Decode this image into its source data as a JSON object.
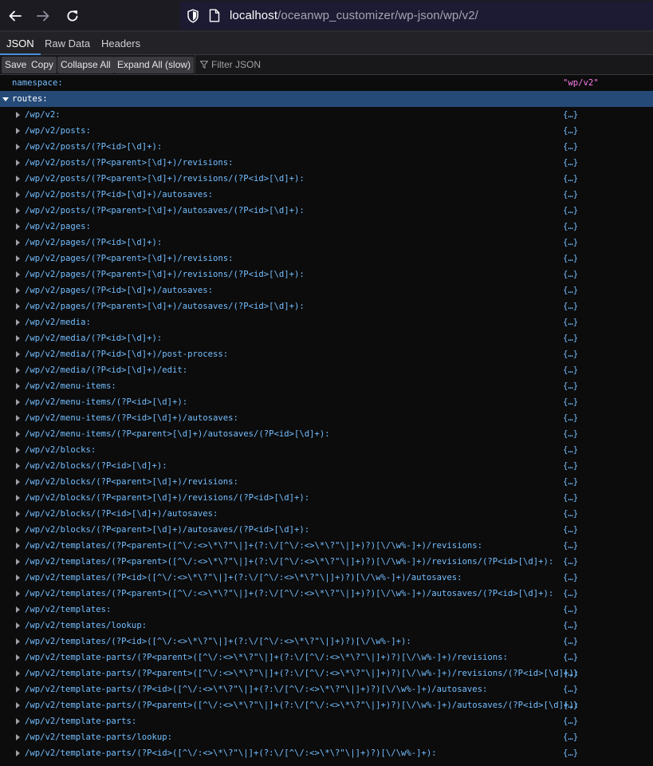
{
  "browser": {
    "back_icon": "arrow-left-icon",
    "forward_icon": "arrow-right-icon",
    "reload_icon": "reload-icon",
    "url_host": "localhost",
    "url_path": "/oceanwp_customizer/wp-json/wp/v2/"
  },
  "tabs": [
    {
      "label": "JSON",
      "active": true
    },
    {
      "label": "Raw Data",
      "active": false
    },
    {
      "label": "Headers",
      "active": false
    }
  ],
  "toolbar": {
    "save_label": "Save",
    "copy_label": "Copy",
    "collapse_label": "Collapse All",
    "expand_label": "Expand All (slow)",
    "filter_placeholder": "Filter JSON"
  },
  "tree": {
    "namespace_key": "namespace:",
    "namespace_value": "\"wp/v2\"",
    "routes_key": "routes:",
    "collapsed_value": "{…}",
    "routes": [
      "/wp/v2:",
      "/wp/v2/posts:",
      "/wp/v2/posts/(?P<id>[\\d]+):",
      "/wp/v2/posts/(?P<parent>[\\d]+)/revisions:",
      "/wp/v2/posts/(?P<parent>[\\d]+)/revisions/(?P<id>[\\d]+):",
      "/wp/v2/posts/(?P<id>[\\d]+)/autosaves:",
      "/wp/v2/posts/(?P<parent>[\\d]+)/autosaves/(?P<id>[\\d]+):",
      "/wp/v2/pages:",
      "/wp/v2/pages/(?P<id>[\\d]+):",
      "/wp/v2/pages/(?P<parent>[\\d]+)/revisions:",
      "/wp/v2/pages/(?P<parent>[\\d]+)/revisions/(?P<id>[\\d]+):",
      "/wp/v2/pages/(?P<id>[\\d]+)/autosaves:",
      "/wp/v2/pages/(?P<parent>[\\d]+)/autosaves/(?P<id>[\\d]+):",
      "/wp/v2/media:",
      "/wp/v2/media/(?P<id>[\\d]+):",
      "/wp/v2/media/(?P<id>[\\d]+)/post-process:",
      "/wp/v2/media/(?P<id>[\\d]+)/edit:",
      "/wp/v2/menu-items:",
      "/wp/v2/menu-items/(?P<id>[\\d]+):",
      "/wp/v2/menu-items/(?P<id>[\\d]+)/autosaves:",
      "/wp/v2/menu-items/(?P<parent>[\\d]+)/autosaves/(?P<id>[\\d]+):",
      "/wp/v2/blocks:",
      "/wp/v2/blocks/(?P<id>[\\d]+):",
      "/wp/v2/blocks/(?P<parent>[\\d]+)/revisions:",
      "/wp/v2/blocks/(?P<parent>[\\d]+)/revisions/(?P<id>[\\d]+):",
      "/wp/v2/blocks/(?P<id>[\\d]+)/autosaves:",
      "/wp/v2/blocks/(?P<parent>[\\d]+)/autosaves/(?P<id>[\\d]+):",
      "/wp/v2/templates/(?P<parent>([^\\/:<>\\*\\?\"\\|]+(?:\\/[^\\/:<>\\*\\?\"\\|]+)?)[\\/\\w%-]+)/revisions:",
      "/wp/v2/templates/(?P<parent>([^\\/:<>\\*\\?\"\\|]+(?:\\/[^\\/:<>\\*\\?\"\\|]+)?)[\\/\\w%-]+)/revisions/(?P<id>[\\d]+):",
      "/wp/v2/templates/(?P<id>([^\\/:<>\\*\\?\"\\|]+(?:\\/[^\\/:<>\\*\\?\"\\|]+)?)[\\/\\w%-]+)/autosaves:",
      "/wp/v2/templates/(?P<parent>([^\\/:<>\\*\\?\"\\|]+(?:\\/[^\\/:<>\\*\\?\"\\|]+)?)[\\/\\w%-]+)/autosaves/(?P<id>[\\d]+):",
      "/wp/v2/templates:",
      "/wp/v2/templates/lookup:",
      "/wp/v2/templates/(?P<id>([^\\/:<>\\*\\?\"\\|]+(?:\\/[^\\/:<>\\*\\?\"\\|]+)?)[\\/\\w%-]+):",
      "/wp/v2/template-parts/(?P<parent>([^\\/:<>\\*\\?\"\\|]+(?:\\/[^\\/:<>\\*\\?\"\\|]+)?)[\\/\\w%-]+)/revisions:",
      "/wp/v2/template-parts/(?P<parent>([^\\/:<>\\*\\?\"\\|]+(?:\\/[^\\/:<>\\*\\?\"\\|]+)?)[\\/\\w%-]+)/revisions/(?P<id>[\\d]+):",
      "/wp/v2/template-parts/(?P<id>([^\\/:<>\\*\\?\"\\|]+(?:\\/[^\\/:<>\\*\\?\"\\|]+)?)[\\/\\w%-]+)/autosaves:",
      "/wp/v2/template-parts/(?P<parent>([^\\/:<>\\*\\?\"\\|]+(?:\\/[^\\/:<>\\*\\?\"\\|]+)?)[\\/\\w%-]+)/autosaves/(?P<id>[\\d]+):",
      "/wp/v2/template-parts:",
      "/wp/v2/template-parts/lookup:",
      "/wp/v2/template-parts/(?P<id>([^\\/:<>\\*\\?\"\\|]+(?:\\/[^\\/:<>\\*\\?\"\\|]+)?)[\\/\\w%-]+):"
    ]
  },
  "colors": {
    "background": "#0c0c0d",
    "key": "#75bfff",
    "string": "#ff7de9",
    "selection": "#254a77"
  }
}
